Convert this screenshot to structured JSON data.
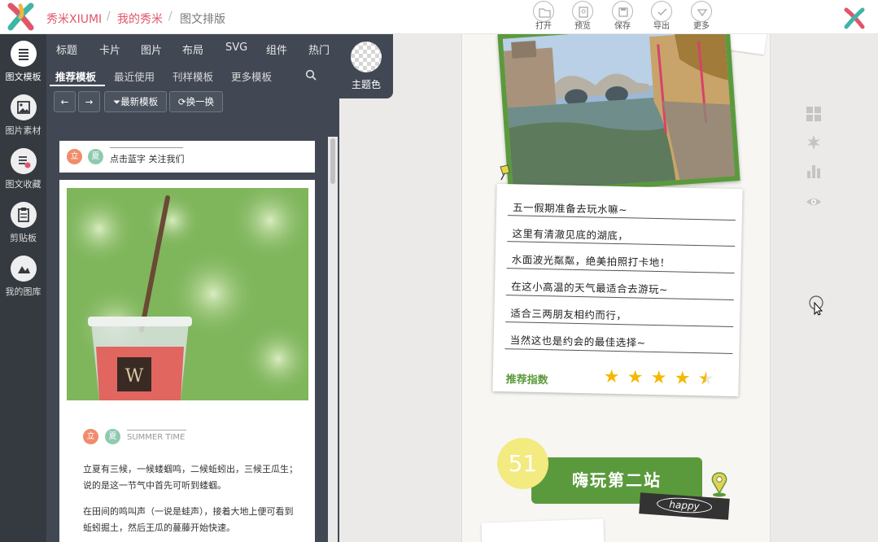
{
  "topbar": {
    "brand": "秀米XIUMI",
    "breadcrumb_link": "我的秀米",
    "breadcrumb_current": "图文排版",
    "separator": "/",
    "tools": [
      {
        "label": "打开",
        "icon": "folder-icon"
      },
      {
        "label": "预览",
        "icon": "preview-icon"
      },
      {
        "label": "保存",
        "icon": "save-icon"
      },
      {
        "label": "导出",
        "icon": "check-icon"
      },
      {
        "label": "更多",
        "icon": "more-icon"
      }
    ]
  },
  "rail": {
    "items": [
      {
        "label": "图文模板",
        "icon": "list-icon",
        "active": true
      },
      {
        "label": "图片素材",
        "icon": "image-icon",
        "active": false
      },
      {
        "label": "图文收藏",
        "icon": "favorite-icon",
        "active": false
      },
      {
        "label": "剪贴板",
        "icon": "clipboard-icon",
        "active": false
      },
      {
        "label": "我的图库",
        "icon": "gallery-icon",
        "active": false
      }
    ]
  },
  "panel": {
    "categories": [
      "标题",
      "卡片",
      "图片",
      "布局",
      "SVG",
      "组件",
      "热门"
    ],
    "subtabs": [
      "推荐模板",
      "最近使用",
      "刊样模板",
      "更多模板"
    ],
    "active_subtab": "推荐模板",
    "theme_label": "主题色",
    "buttons": {
      "prev": "←",
      "next": "→",
      "latest": "最新模板",
      "shuffle": "换一换"
    }
  },
  "templates": {
    "follow_tag1": "立",
    "follow_tag2": "夏",
    "follow_text": "点击蓝字 关注我们",
    "summer_tag1": "立",
    "summer_tag2": "夏",
    "summer_title": "SUMMER TIME",
    "cup_letter": "W",
    "para1": "立夏有三候，一候蝼蝈鸣，二候蚯蚓出，三候王瓜生；说的是这一节气中首先可听到蝼蝈。",
    "para2": "在田间的鸣叫声（一说是蛙声），接着大地上便可看到蚯蚓掘土，然后王瓜的蔓藤开始快速。"
  },
  "document": {
    "lines": [
      "五一假期准备去玩水嘛~",
      "这里有清澈见底的湖底，",
      "水面波光粼粼，绝美拍照打卡地！",
      "在这小高温的天气最适合去游玩~",
      "适合三两朋友相约而行，",
      "当然这也是约会的最佳选择~"
    ],
    "recommend_label": "推荐指数",
    "rating": 4.5,
    "rating_max": 5,
    "section_number": "51",
    "section_title": "嗨玩第二站",
    "happy": "happy"
  },
  "colors": {
    "brand": "#e1556a",
    "panel_bg": "#414853",
    "rail_bg": "#343a40",
    "accent_green": "#5b9a3c",
    "star": "#f5b700",
    "circle_yellow": "#f3ea80"
  },
  "right_tools": [
    "grid-icon",
    "puzzle-icon",
    "bar-chart-icon",
    "eye-icon"
  ]
}
